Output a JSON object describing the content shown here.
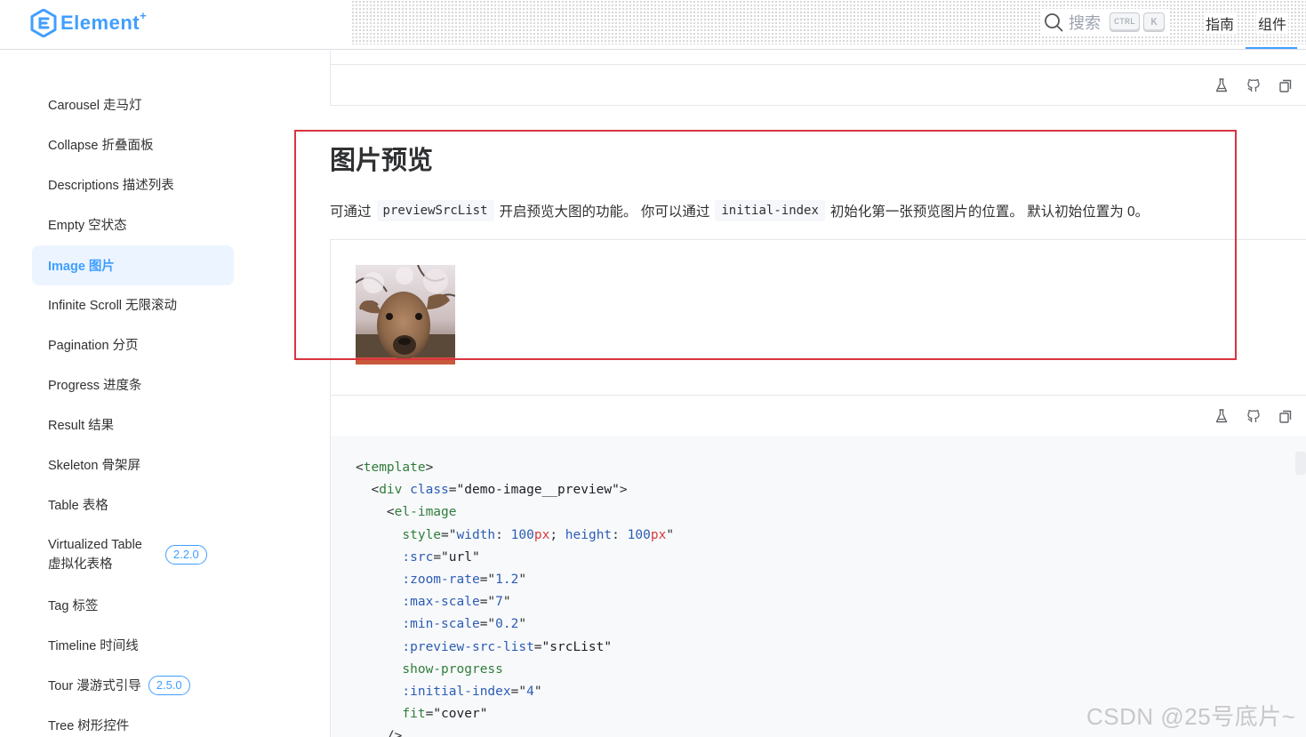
{
  "header": {
    "logo_text": "Element",
    "logo_plus": "+",
    "search_label": "搜索",
    "shortcut_ctrl": "CTRL",
    "shortcut_k": "K",
    "nav_guide": "指南",
    "nav_components": "组件"
  },
  "sidebar": {
    "items": [
      {
        "label": "Carousel 走马灯"
      },
      {
        "label": "Collapse 折叠面板"
      },
      {
        "label": "Descriptions 描述列表"
      },
      {
        "label": "Empty 空状态"
      },
      {
        "label": "Image 图片",
        "active": true
      },
      {
        "label": "Infinite Scroll 无限滚动"
      },
      {
        "label": "Pagination 分页"
      },
      {
        "label": "Progress 进度条"
      },
      {
        "label": "Result 结果"
      },
      {
        "label": "Skeleton 骨架屏"
      },
      {
        "label": "Table 表格"
      },
      {
        "label_line1": "Virtualized Table",
        "label_line2": "虚拟化表格",
        "badge": "2.2.0"
      },
      {
        "label": "Tag 标签"
      },
      {
        "label": "Timeline 时间线"
      },
      {
        "label": "Tour 漫游式引导",
        "badge": "2.5.0"
      },
      {
        "label": "Tree 树形控件"
      }
    ]
  },
  "main": {
    "title": "图片预览",
    "desc_1": "可通过",
    "desc_code_1": "previewSrcList",
    "desc_2": "开启预览大图的功能。 你可以通过",
    "desc_code_2": "initial-index",
    "desc_3": "初始化第一张预览图片的位置。 默认初始位置为 0。",
    "toolbar_icons": [
      "flask-icon",
      "github-icon",
      "copy-icon"
    ]
  },
  "code": {
    "l1_tag": "template",
    "l2_tag": "div",
    "l2_attr": "class",
    "l2_val": "\"demo-image__preview\"",
    "l3_tag": "el-image",
    "l4_attr": "style",
    "l4_k1": "width",
    "l4_n1": "100",
    "l4_u1": "px",
    "l4_k2": "height",
    "l4_n2": "100",
    "l4_u2": "px",
    "l5_attr": ":src",
    "l5_val": "\"url\"",
    "l6_attr": ":zoom-rate",
    "l6_val": "1.2",
    "l7_attr": ":max-scale",
    "l7_val": "7",
    "l8_attr": ":min-scale",
    "l8_val": "0.2",
    "l9_attr": ":preview-src-list",
    "l9_val": "\"srcList\"",
    "l10_attr": "show-progress",
    "l11_attr": ":initial-index",
    "l11_val": "4",
    "l12_attr": "fit",
    "l12_val": "\"cover\"",
    "l13": "/>"
  },
  "watermark": "CSDN @25号底片~",
  "colors": {
    "accent": "#409eff",
    "active_bg": "#ecf5ff",
    "highlight_box": "#d9343f"
  }
}
